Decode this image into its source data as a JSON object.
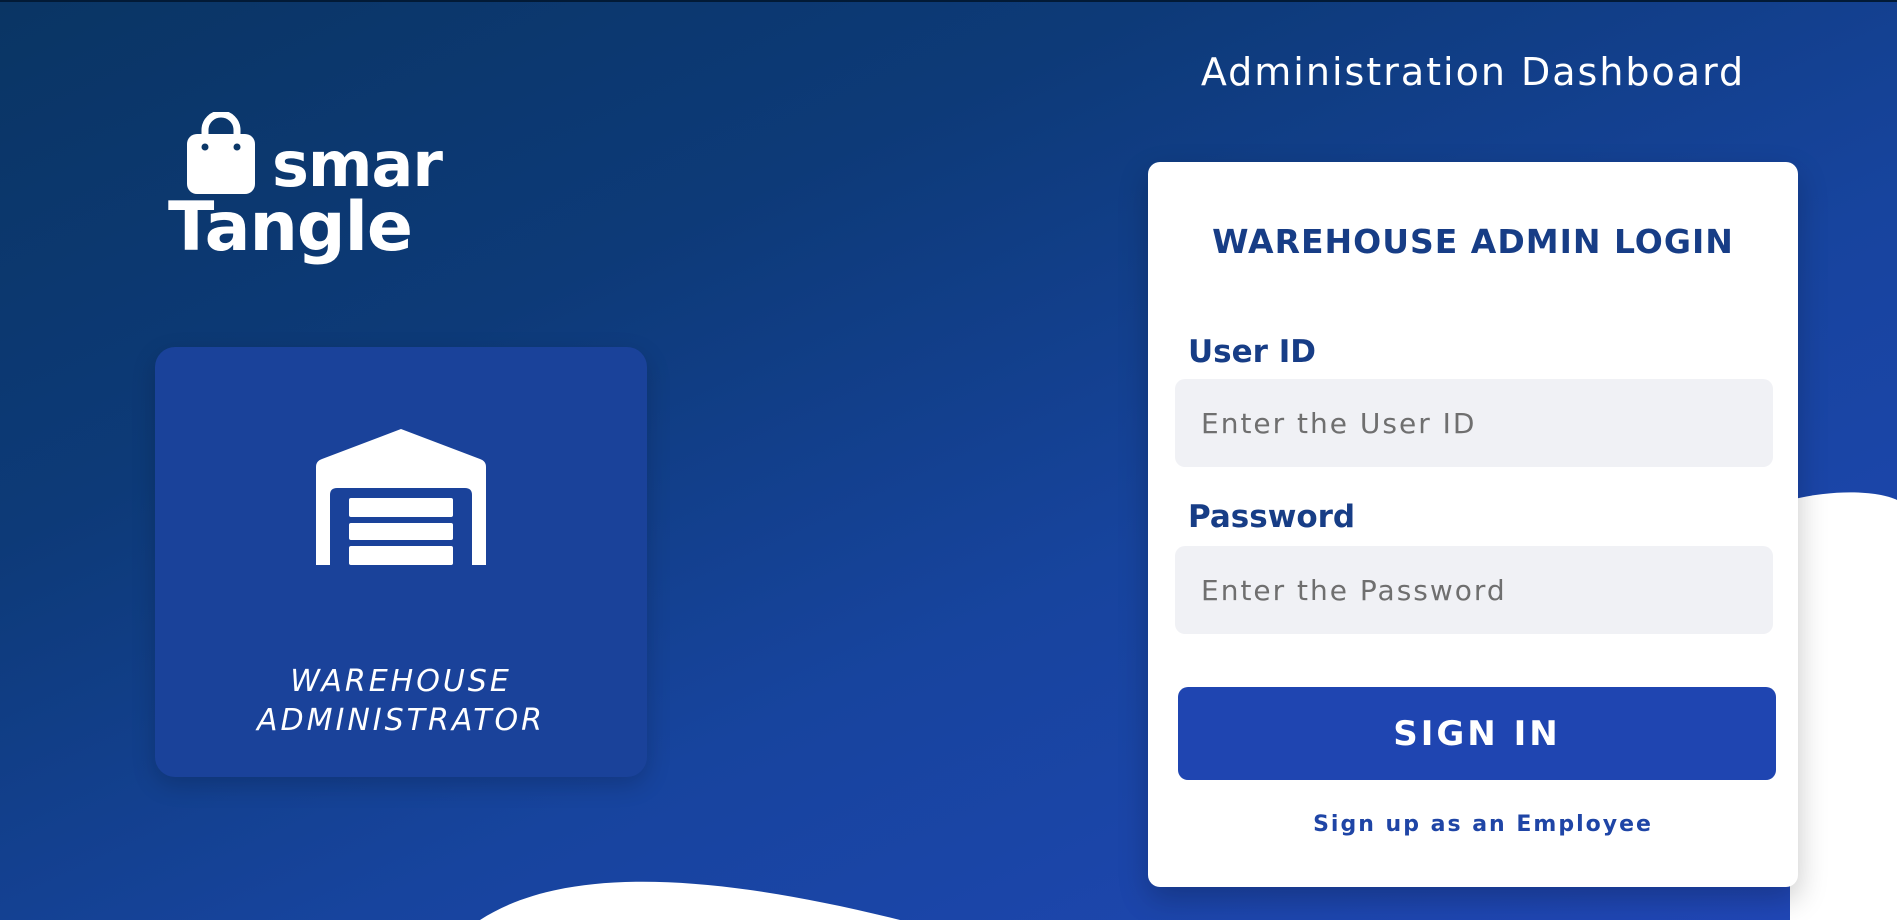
{
  "brand": {
    "line1": "smar",
    "line2": "Tangle"
  },
  "role_card": {
    "label_line1": "WAREHOUSE",
    "label_line2": "ADMINISTRATOR"
  },
  "header": {
    "title": "Administration Dashboard"
  },
  "login": {
    "title": "WAREHOUSE ADMIN LOGIN",
    "user_label": "User ID",
    "user_placeholder": "Enter the User ID",
    "user_value": "",
    "password_label": "Password",
    "password_placeholder": "Enter the Password",
    "password_value": "",
    "signin_label": "SIGN IN",
    "signup_link": "Sign up as an Employee"
  },
  "colors": {
    "background_dark": "#0a3564",
    "background_light": "#2147b8",
    "card_blue": "#1a429a",
    "button_blue": "#1f45b1",
    "heading_blue": "#173d86",
    "input_bg": "#f0f1f5",
    "white": "#ffffff"
  },
  "icons": {
    "logo": "shopping-bag-icon",
    "role": "warehouse-garage-icon"
  }
}
